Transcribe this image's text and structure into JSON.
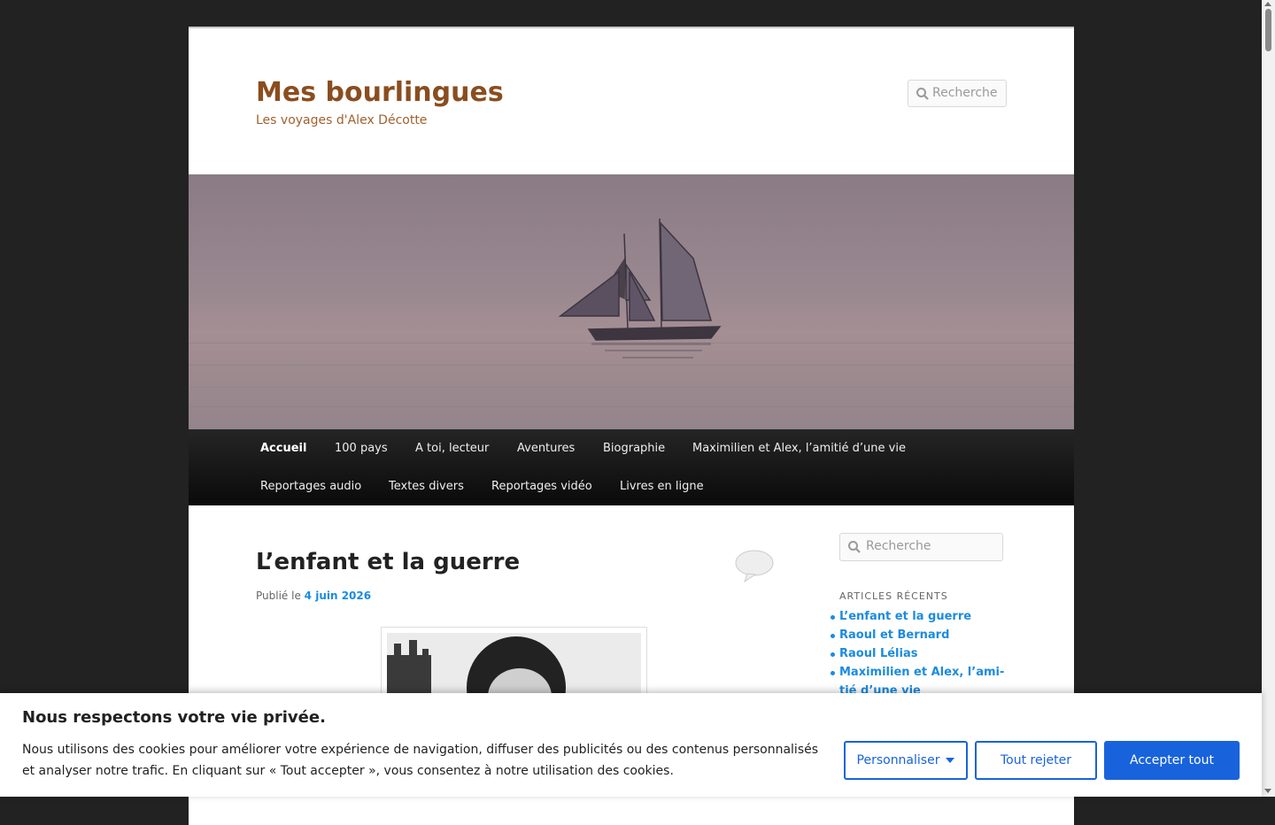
{
  "site": {
    "title": "Mes bourlingues",
    "description": "Les voyages d'Alex Décotte",
    "search_placeholder": "Recherche"
  },
  "nav": {
    "items": [
      {
        "label": "Accueil",
        "active": true
      },
      {
        "label": "100 pays"
      },
      {
        "label": "A toi, lecteur"
      },
      {
        "label": "Aventures"
      },
      {
        "label": "Biographie"
      },
      {
        "label": "Maximilien et Alex, l’amitié d’une vie"
      },
      {
        "label": "Reportages audio"
      },
      {
        "label": "Textes divers"
      },
      {
        "label": "Reportages vidéo"
      },
      {
        "label": "Livres en ligne"
      }
    ]
  },
  "article": {
    "title": "L’enfant et la guerre",
    "posted_prefix": "Publié le",
    "date": "4 juin 2026"
  },
  "sidebar": {
    "search_placeholder": "Recherche",
    "recent_title": "ARTICLES RÉCENTS",
    "recent": [
      "L’enfant et la guerre",
      "Raoul et Bernard",
      "Raoul Lélias",
      "Maximilien et Alex, l’ami-",
      "tié d’une vie"
    ]
  },
  "cookie": {
    "title": "Nous respectons votre vie privée.",
    "text": "Nous utilisons des cookies pour améliorer votre expérience de navigation, diffuser des publicités ou des contenus personnalisés et analyser notre trafic. En cliquant sur « Tout accepter », vous consentez à notre utilisation des cookies.",
    "customize": "Personnaliser",
    "reject": "Tout rejeter",
    "accept": "Accepter tout"
  },
  "colors": {
    "background": "#222222",
    "title": "#8a4d1f",
    "link": "#1b8be0",
    "button": "#1863dc"
  }
}
